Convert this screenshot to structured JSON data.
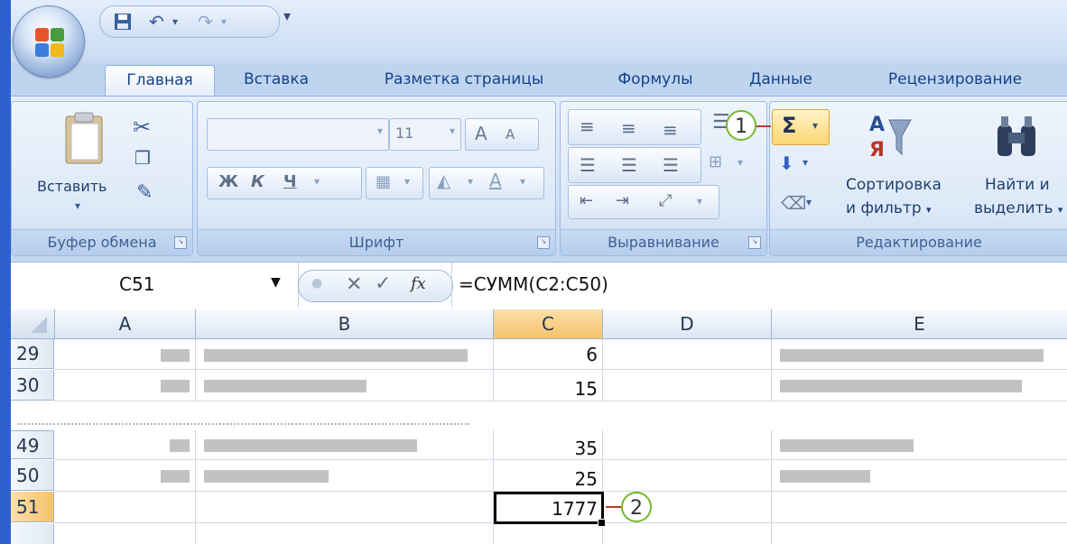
{
  "tabs": [
    "Главная",
    "Вставка",
    "Разметка страницы",
    "Формулы",
    "Данные",
    "Рецензирование"
  ],
  "active_tab": "Главная",
  "ribbon": {
    "clipboard": {
      "paste_label": "Вставить",
      "group_label": "Буфер обмена"
    },
    "font": {
      "font_name": "",
      "font_size": "11",
      "bold": "Ж",
      "italic": "К",
      "underline": "Ч",
      "group_label": "Шрифт"
    },
    "alignment": {
      "group_label": "Выравнивание"
    },
    "editing": {
      "sort_label_1": "Сортировка",
      "sort_label_2": "и фильтр",
      "find_label_1": "Найти и",
      "find_label_2": "выделить",
      "group_label": "Редактирование",
      "autosum_symbol": "Σ"
    }
  },
  "formula_bar": {
    "name_box": "C51",
    "fx": "fx",
    "formula": "=СУММ(C2:C50)"
  },
  "columns": [
    "A",
    "B",
    "C",
    "D",
    "E"
  ],
  "selected_column": "C",
  "rows": [
    {
      "label": "29",
      "c": "6"
    },
    {
      "label": "30",
      "c": "15"
    },
    {
      "label": "49",
      "c": "35"
    },
    {
      "label": "50",
      "c": "25"
    },
    {
      "label": "51",
      "c": "1777"
    }
  ],
  "selected_row": "51",
  "callouts": [
    "1",
    "2"
  ],
  "colors": {
    "accent": "#15428b",
    "selection": "#f6c26b",
    "callout": "#76b82a",
    "connector": "#c0392b"
  }
}
